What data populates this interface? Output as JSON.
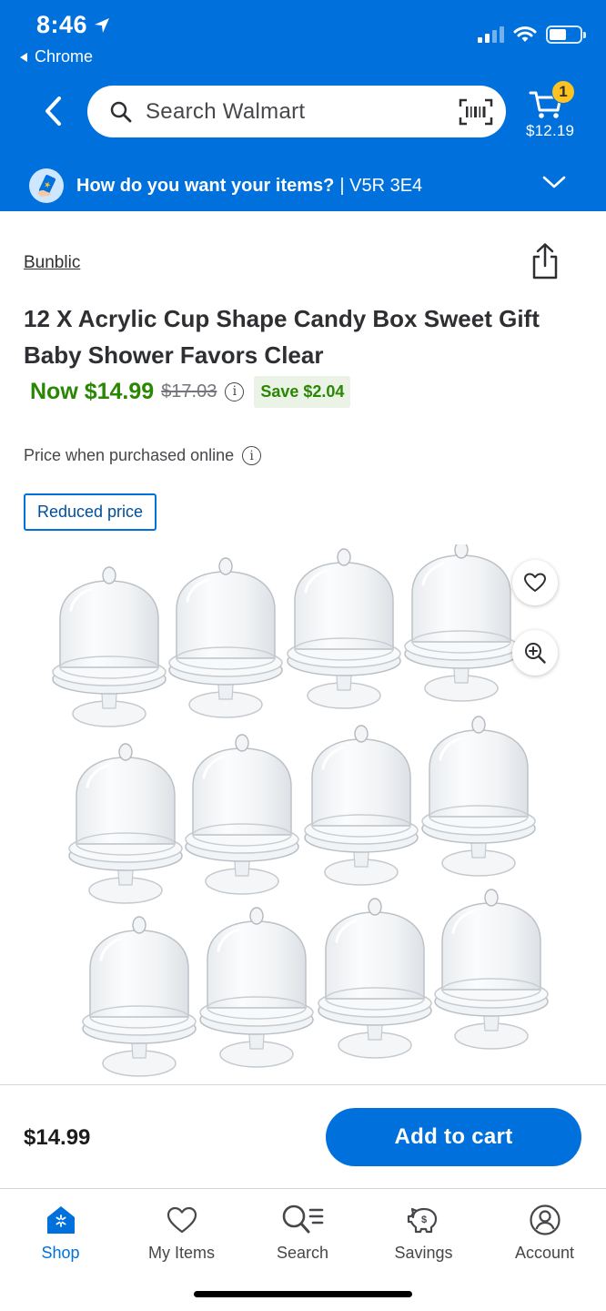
{
  "status_bar": {
    "time": "8:46",
    "back_app": "Chrome"
  },
  "header": {
    "search_placeholder": "Search Walmart",
    "cart_count": "1",
    "cart_total": "$12.19",
    "delivery_question": "How do you want your items?",
    "delivery_zip": "| V5R 3E4"
  },
  "product": {
    "brand": "Bunblic",
    "title": "12 X Acrylic Cup Shape Candy Box Sweet Gift Baby Shower Favors Clear",
    "now_price": "Now $14.99",
    "was_price": "$17.03",
    "save_label": "Save $2.04",
    "price_note": "Price when purchased online",
    "tag": "Reduced price",
    "image_grid": {
      "rows": 3,
      "cols": 4,
      "item": "clear acrylic cloche cup"
    }
  },
  "purchase_bar": {
    "price": "$14.99",
    "add_to_cart_label": "Add to cart"
  },
  "bottom_nav": {
    "items": [
      {
        "label": "Shop",
        "icon": "shop-icon",
        "active": true
      },
      {
        "label": "My Items",
        "icon": "heart-icon",
        "active": false
      },
      {
        "label": "Search",
        "icon": "search-list-icon",
        "active": false
      },
      {
        "label": "Savings",
        "icon": "piggy-bank-icon",
        "active": false
      },
      {
        "label": "Account",
        "icon": "account-icon",
        "active": false
      }
    ]
  },
  "colors": {
    "brand_blue": "#0071dc",
    "price_green": "#2a8703",
    "badge_yellow": "#ffc220"
  }
}
